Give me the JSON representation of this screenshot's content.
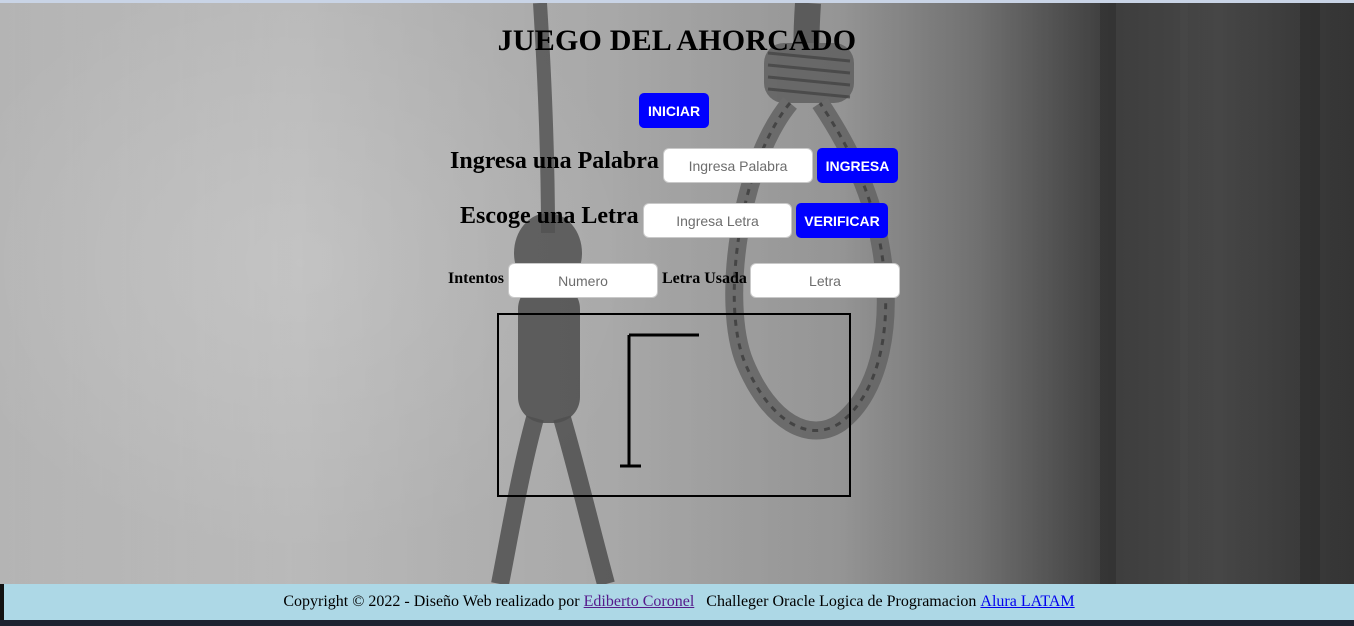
{
  "title": "JUEGO DEL AHORCADO",
  "start_button": "INICIAR",
  "word_row": {
    "label": "Ingresa una Palabra",
    "placeholder": "Ingresa Palabra",
    "button": "INGRESA"
  },
  "letter_row": {
    "label": "Escoge una Letra",
    "placeholder": "Ingresa Letra",
    "button": "VERIFICAR"
  },
  "stats_row": {
    "attempts_label": "Intentos",
    "attempts_placeholder": "Numero",
    "used_label": "Letra Usada",
    "used_placeholder": "Letra"
  },
  "footer": {
    "prefix": "Copyright © 2022 - Diseño Web realizado por ",
    "author_link": "Ediberto Coronel",
    "middle": "   Challeger Oracle Logica de Programacion ",
    "org_link": "Alura LATAM"
  },
  "colors": {
    "button_bg": "#0000ff",
    "footer_bg": "#add8e6"
  }
}
